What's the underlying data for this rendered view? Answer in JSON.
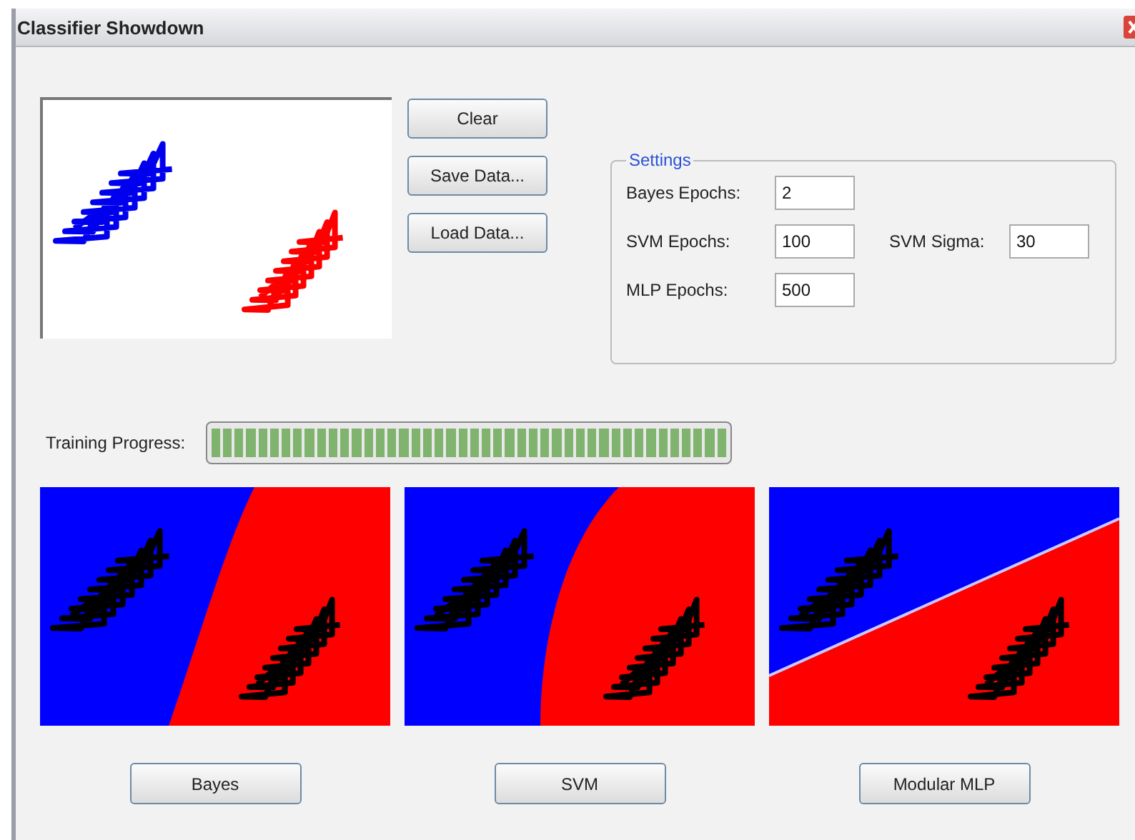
{
  "window": {
    "title": "Classifier Showdown"
  },
  "data_buttons": [
    "Clear",
    "Save Data...",
    "Load Data..."
  ],
  "settings": {
    "title": "Settings",
    "fields": [
      {
        "label": "Bayes Epochs:",
        "value": "2"
      },
      {
        "label": "SVM Epochs:",
        "value": "100"
      },
      {
        "label": "SVM Sigma:",
        "value": "30"
      },
      {
        "label": "MLP Epochs:",
        "value": "500"
      }
    ]
  },
  "training": {
    "label": "Training Progress:",
    "level": 1
  },
  "classifiers": [
    {
      "kind": "bayes",
      "button": "Bayes"
    },
    {
      "kind": "svm",
      "button": "SVM"
    },
    {
      "kind": "mlp",
      "button": "Modular MLP"
    }
  ]
}
